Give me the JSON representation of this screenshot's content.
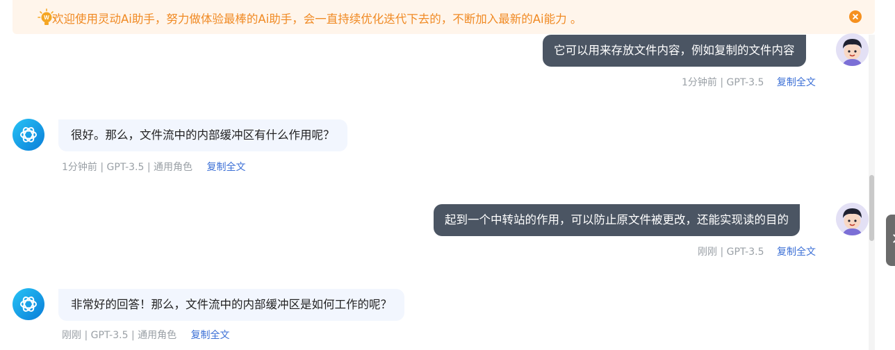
{
  "banner": {
    "text": "欢迎使用灵动Ai助手，努力做体验最棒的Ai助手，会一直持续优化迭代下去的，不断加入最新的Ai能力 。",
    "icon": "lightbulb-icon",
    "close_icon": "close-icon",
    "accent": "#f08a24"
  },
  "messages": [
    {
      "role": "user",
      "text": "它可以用来存放文件内容，例如复制的文件内容",
      "meta": "1分钟前 | GPT-3.5",
      "copy_label": "复制全文"
    },
    {
      "role": "assistant",
      "text": "很好。那么，文件流中的内部缓冲区有什么作用呢？",
      "meta": "1分钟前  |  GPT-3.5  |  通用角色",
      "copy_label": "复制全文"
    },
    {
      "role": "user",
      "text": "起到一个中转站的作用，可以防止原文件被更改，还能实现读的目的",
      "meta": "刚刚 | GPT-3.5",
      "copy_label": "复制全文"
    },
    {
      "role": "assistant",
      "text": "非常好的回答！那么，文件流中的内部缓冲区是如何工作的呢？",
      "meta": "刚刚  |  GPT-3.5  |  通用角色",
      "copy_label": "复制全文"
    }
  ],
  "colors": {
    "user_bubble": "#4b5563",
    "bot_bubble": "#f2f6fe",
    "link": "#3b6fd6"
  }
}
